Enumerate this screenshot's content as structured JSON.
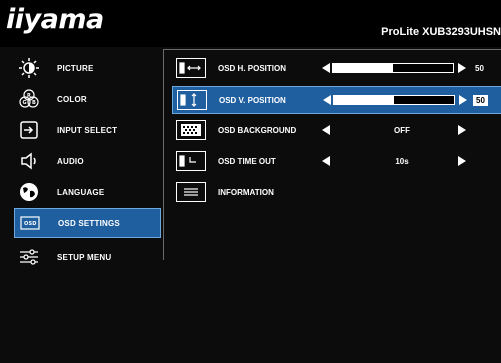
{
  "brand": {
    "logo_text": "iiyama",
    "model": "ProLite XUB3293UHSN"
  },
  "sidebar": {
    "items": [
      {
        "label": "PICTURE",
        "icon": "brightness-icon"
      },
      {
        "label": "COLOR",
        "icon": "rgb-icon"
      },
      {
        "label": "INPUT SELECT",
        "icon": "input-icon"
      },
      {
        "label": "AUDIO",
        "icon": "speaker-icon"
      },
      {
        "label": "LANGUAGE",
        "icon": "globe-icon"
      },
      {
        "label": "OSD SETTINGS",
        "icon": "osd-icon",
        "active": true
      },
      {
        "label": "SETUP MENU",
        "icon": "sliders-icon"
      }
    ]
  },
  "settings": {
    "rows": [
      {
        "label": "OSD H. POSITION",
        "icon": "h-position-icon",
        "type": "slider",
        "value": "50",
        "level": 0.5
      },
      {
        "label": "OSD V. POSITION",
        "icon": "v-position-icon",
        "type": "slider",
        "value": "50",
        "level": 0.5,
        "active": true
      },
      {
        "label": "OSD BACKGROUND",
        "icon": "background-icon",
        "type": "choice",
        "value": "OFF"
      },
      {
        "label": "OSD TIME OUT",
        "icon": "timer-icon",
        "type": "choice",
        "value": "10s"
      },
      {
        "label": "INFORMATION",
        "icon": "info-icon",
        "type": "none"
      }
    ]
  },
  "colors": {
    "accent": "#1f5fa0",
    "accent_border": "#6fa8dc",
    "background": "#000000"
  }
}
